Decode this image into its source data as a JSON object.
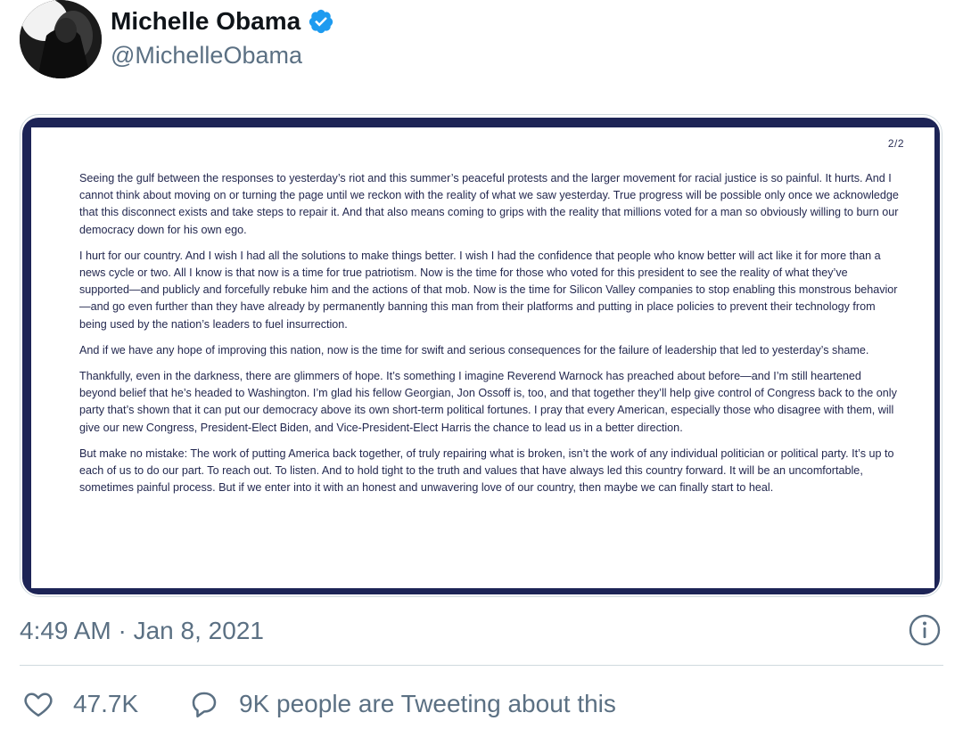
{
  "author": {
    "display_name": "Michelle Obama",
    "handle": "@MichelleObama",
    "verified": true,
    "avatar_icon": "profile-photo-silhouette"
  },
  "media": {
    "page_indicator": "2/2",
    "paragraphs": [
      "Seeing the gulf between the responses to yesterday’s riot and this summer’s peaceful protests and the larger movement for racial justice is so painful. It hurts. And I cannot think about moving on or turning the page until we reckon with the reality of what we saw yesterday. True progress will be possible only once we acknowledge that this disconnect exists and take steps to repair it. And that also means coming to grips with the reality that millions voted for a man so obviously willing to burn our democracy down for his own ego.",
      "I hurt for our country. And I wish I had all the solutions to make things better. I wish I had the confidence that people who know better will act like it for more than a news cycle or two. All I know is that now is a time for true patriotism. Now is the time for those who voted for this president to see the reality of what they’ve supported—and publicly and forcefully rebuke him and the actions of that mob. Now is the time for Silicon Valley companies to stop enabling this monstrous behavior—and go even further than they have already by permanently banning this man from their platforms and putting in place policies to prevent their technology from being used by the nation’s leaders to fuel insurrection.",
      "And if we have any hope of improving this nation, now is the time for swift and serious consequences for the failure of leadership that led to yesterday’s shame.",
      "Thankfully, even in the darkness, there are glimmers of hope. It’s something I imagine Reverend Warnock has preached about before—and I’m still heartened beyond belief that he’s headed to Washington. I’m glad his fellow Georgian, Jon Ossoff is, too, and that together they’ll help give control of Congress back to the only party that’s shown that it can put our democracy above its own short-term political fortunes. I pray that every American, especially those who disagree with them, will give our new Congress, President-Elect Biden, and Vice-President-Elect Harris the chance to lead us in a better direction.",
      "But make no mistake: The work of putting America back together, of truly repairing what is broken, isn’t the work of any individual politician or political party. It’s up to each of us to do our part. To reach out. To listen. And to hold tight to the truth and values that have always led this country forward. It will be an uncomfortable, sometimes painful process. But if we enter into it with an honest and unwavering love of our country, then maybe we can finally start to heal."
    ]
  },
  "timestamp": "4:49 AM · Jan 8, 2021",
  "actions": {
    "like_count": "47.7K",
    "tweeting_about": "9K people are Tweeting about this"
  },
  "colors": {
    "text_primary": "#0f1419",
    "text_secondary": "#5b7083",
    "verified_blue": "#1d9bf0",
    "frame_navy": "#1d2456",
    "divider": "#cfd9de"
  },
  "icons": {
    "verified": "verified-badge-icon",
    "info": "info-icon",
    "like": "heart-icon",
    "reply": "speech-bubble-icon"
  }
}
